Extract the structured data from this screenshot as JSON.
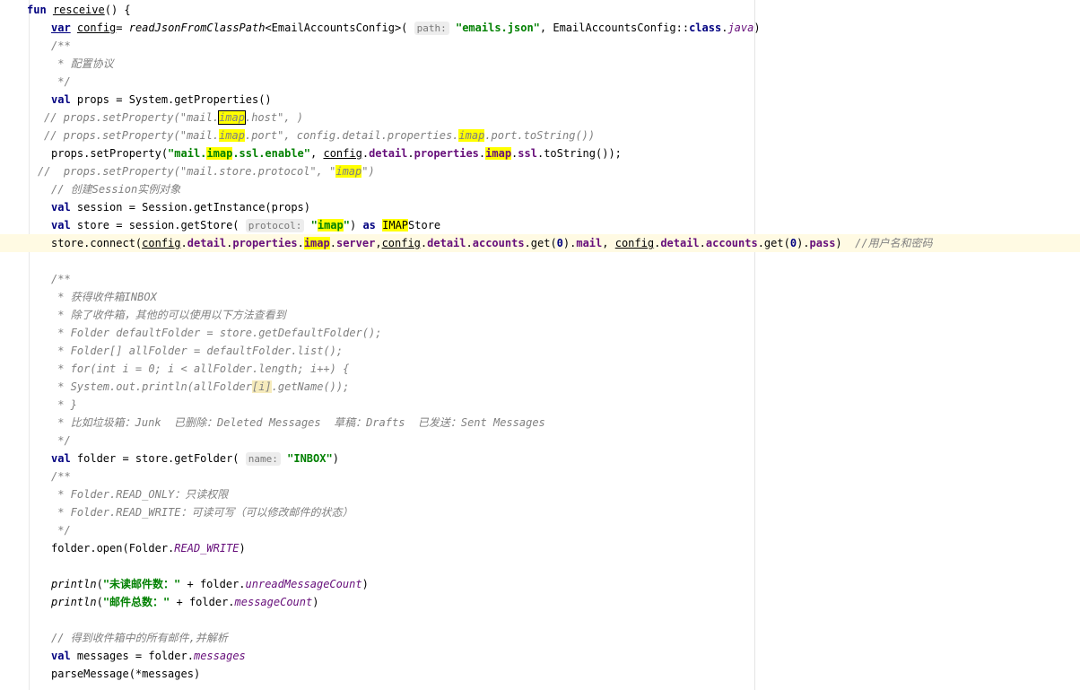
{
  "editor": {
    "lines": [
      {
        "indent": 30,
        "segs": [
          {
            "t": "fun",
            "c": "kw"
          },
          {
            "t": " "
          },
          {
            "t": "resceive",
            "c": "ul"
          },
          {
            "t": "() {"
          }
        ]
      },
      {
        "indent": 57,
        "segs": [
          {
            "t": "var",
            "c": "kw ul"
          },
          {
            "t": " "
          },
          {
            "t": "config",
            "c": "ul"
          },
          {
            "t": "= "
          },
          {
            "t": "readJsonFromClassPath",
            "c": "it"
          },
          {
            "t": "<EmailAccountsConfig>( "
          },
          {
            "t": "path:",
            "c": "hint"
          },
          {
            "t": " "
          },
          {
            "t": "\"emails.json\"",
            "c": "str"
          },
          {
            "t": ", EmailAccountsConfig::"
          },
          {
            "t": "class",
            "c": "kw"
          },
          {
            "t": "."
          },
          {
            "t": "java",
            "c": "sfld"
          },
          {
            "t": ")"
          }
        ]
      },
      {
        "indent": 57,
        "segs": [
          {
            "t": "/**",
            "c": "cmt"
          }
        ]
      },
      {
        "indent": 57,
        "segs": [
          {
            "t": " * 配置协议",
            "c": "cmt"
          }
        ]
      },
      {
        "indent": 57,
        "segs": [
          {
            "t": " */",
            "c": "cmt"
          }
        ]
      },
      {
        "indent": 57,
        "segs": [
          {
            "t": "val",
            "c": "kw"
          },
          {
            "t": " props = System.getProperties()"
          }
        ]
      },
      {
        "indent": 49,
        "segs": [
          {
            "t": "// props.setProperty(\"mail.",
            "c": "cmt"
          },
          {
            "t": "imap",
            "c": "cmt hlbox"
          },
          {
            "t": ".host\", )",
            "c": "cmt"
          }
        ]
      },
      {
        "indent": 49,
        "segs": [
          {
            "t": "// props.setProperty(\"mail.",
            "c": "cmt"
          },
          {
            "t": "imap",
            "c": "cmt hl"
          },
          {
            "t": ".port\", config.detail.properties.",
            "c": "cmt"
          },
          {
            "t": "imap",
            "c": "cmt hl"
          },
          {
            "t": ".port.toString())",
            "c": "cmt"
          }
        ]
      },
      {
        "indent": 57,
        "segs": [
          {
            "t": "props.setProperty("
          },
          {
            "t": "\"mail.",
            "c": "str"
          },
          {
            "t": "imap",
            "c": "str hl"
          },
          {
            "t": ".ssl.enable\"",
            "c": "str"
          },
          {
            "t": ", "
          },
          {
            "t": "config",
            "c": "ul"
          },
          {
            "t": "."
          },
          {
            "t": "detail",
            "c": "fld"
          },
          {
            "t": "."
          },
          {
            "t": "properties",
            "c": "fld"
          },
          {
            "t": "."
          },
          {
            "t": "imap",
            "c": "fld hl"
          },
          {
            "t": "."
          },
          {
            "t": "ssl",
            "c": "fld"
          },
          {
            "t": ".toString());"
          }
        ]
      },
      {
        "indent": 42,
        "segs": [
          {
            "t": "//  props.setProperty(\"mail.store.protocol\", \"",
            "c": "cmt"
          },
          {
            "t": "imap",
            "c": "cmt hl"
          },
          {
            "t": "\")",
            "c": "cmt"
          }
        ]
      },
      {
        "indent": 57,
        "segs": [
          {
            "t": "// 创建Session实例对象",
            "c": "cmt"
          }
        ]
      },
      {
        "indent": 57,
        "segs": [
          {
            "t": "val",
            "c": "kw"
          },
          {
            "t": " session = Session.getInstance(props)"
          }
        ]
      },
      {
        "indent": 57,
        "segs": [
          {
            "t": "val",
            "c": "kw"
          },
          {
            "t": " store = session.getStore( "
          },
          {
            "t": "protocol:",
            "c": "hint"
          },
          {
            "t": " "
          },
          {
            "t": "\"",
            "c": "str"
          },
          {
            "t": "imap",
            "c": "str hl"
          },
          {
            "t": "\"",
            "c": "str"
          },
          {
            "t": ") "
          },
          {
            "t": "as",
            "c": "kw"
          },
          {
            "t": " "
          },
          {
            "t": "IMAP",
            "c": "hl"
          },
          {
            "t": "Store"
          }
        ]
      },
      {
        "indent": 57,
        "segs": [
          {
            "t": "store.connect("
          },
          {
            "t": "config",
            "c": "ul"
          },
          {
            "t": "."
          },
          {
            "t": "detail",
            "c": "fld"
          },
          {
            "t": "."
          },
          {
            "t": "properties",
            "c": "fld"
          },
          {
            "t": "."
          },
          {
            "t": "imap",
            "c": "fld hl"
          },
          {
            "t": "."
          },
          {
            "t": "server",
            "c": "fld"
          },
          {
            "t": ","
          },
          {
            "t": "config",
            "c": "ul"
          },
          {
            "t": "."
          },
          {
            "t": "detail",
            "c": "fld"
          },
          {
            "t": "."
          },
          {
            "t": "accounts",
            "c": "fld"
          },
          {
            "t": ".get("
          },
          {
            "t": "0",
            "c": "kw"
          },
          {
            "t": ")."
          },
          {
            "t": "mail",
            "c": "fld"
          },
          {
            "t": ", "
          },
          {
            "t": "config",
            "c": "ul"
          },
          {
            "t": "."
          },
          {
            "t": "detail",
            "c": "fld"
          },
          {
            "t": "."
          },
          {
            "t": "accounts",
            "c": "fld"
          },
          {
            "t": ".get("
          },
          {
            "t": "0",
            "c": "kw"
          },
          {
            "t": ")."
          },
          {
            "t": "pass",
            "c": "fld"
          },
          {
            "t": ")  "
          },
          {
            "t": "//用户名和密码",
            "c": "cmt"
          }
        ]
      },
      {
        "indent": 57,
        "segs": []
      },
      {
        "indent": 57,
        "segs": [
          {
            "t": "/**",
            "c": "cmt"
          }
        ]
      },
      {
        "indent": 57,
        "segs": [
          {
            "t": " * 获得收件箱INBOX",
            "c": "cmt"
          }
        ]
      },
      {
        "indent": 57,
        "segs": [
          {
            "t": " * 除了收件箱，其他的可以使用以下方法查看到",
            "c": "cmt"
          }
        ]
      },
      {
        "indent": 57,
        "segs": [
          {
            "t": " * Folder defaultFolder = store.getDefaultFolder();",
            "c": "cmt"
          }
        ]
      },
      {
        "indent": 57,
        "segs": [
          {
            "t": " * Folder[] allFolder = defaultFolder.list();",
            "c": "cmt"
          }
        ]
      },
      {
        "indent": 57,
        "segs": [
          {
            "t": " * for(int i = 0; i < allFolder.length; i++) {",
            "c": "cmt"
          }
        ]
      },
      {
        "indent": 57,
        "segs": [
          {
            "t": " * System.out.println(allFolder",
            "c": "cmt"
          },
          {
            "t": "[i]",
            "c": "cmt warn"
          },
          {
            "t": ".getName());",
            "c": "cmt"
          }
        ]
      },
      {
        "indent": 57,
        "segs": [
          {
            "t": " * }",
            "c": "cmt"
          }
        ]
      },
      {
        "indent": 57,
        "segs": [
          {
            "t": " * 比如垃圾箱：Junk  已删除：Deleted Messages  草稿：Drafts  已发送：Sent Messages",
            "c": "cmt"
          }
        ]
      },
      {
        "indent": 57,
        "segs": [
          {
            "t": " */",
            "c": "cmt"
          }
        ]
      },
      {
        "indent": 57,
        "segs": [
          {
            "t": "val",
            "c": "kw"
          },
          {
            "t": " folder = store.getFolder( "
          },
          {
            "t": "name:",
            "c": "hint"
          },
          {
            "t": " "
          },
          {
            "t": "\"INBOX\"",
            "c": "str"
          },
          {
            "t": ")"
          }
        ]
      },
      {
        "indent": 57,
        "segs": [
          {
            "t": "/**",
            "c": "cmt"
          }
        ]
      },
      {
        "indent": 57,
        "segs": [
          {
            "t": " * Folder.READ_ONLY：只读权限",
            "c": "cmt"
          }
        ]
      },
      {
        "indent": 57,
        "segs": [
          {
            "t": " * Folder.READ_WRITE：可读可写（可以修改邮件的状态）",
            "c": "cmt"
          }
        ]
      },
      {
        "indent": 57,
        "segs": [
          {
            "t": " */",
            "c": "cmt"
          }
        ]
      },
      {
        "indent": 57,
        "segs": [
          {
            "t": "folder.open(Folder."
          },
          {
            "t": "READ_WRITE",
            "c": "sfld"
          },
          {
            "t": ")"
          }
        ]
      },
      {
        "indent": 57,
        "segs": []
      },
      {
        "indent": 57,
        "segs": [
          {
            "t": "println",
            "c": "it"
          },
          {
            "t": "("
          },
          {
            "t": "\"未读邮件数：\"",
            "c": "str"
          },
          {
            "t": " + folder."
          },
          {
            "t": "unreadMessageCount",
            "c": "sfld"
          },
          {
            "t": ")"
          }
        ]
      },
      {
        "indent": 57,
        "segs": [
          {
            "t": "println",
            "c": "it"
          },
          {
            "t": "("
          },
          {
            "t": "\"邮件总数：\"",
            "c": "str"
          },
          {
            "t": " + folder."
          },
          {
            "t": "messageCount",
            "c": "sfld"
          },
          {
            "t": ")"
          }
        ]
      },
      {
        "indent": 57,
        "segs": []
      },
      {
        "indent": 57,
        "segs": [
          {
            "t": "// 得到收件箱中的所有邮件,并解析",
            "c": "cmt"
          }
        ]
      },
      {
        "indent": 57,
        "segs": [
          {
            "t": "val",
            "c": "kw"
          },
          {
            "t": " messages = folder."
          },
          {
            "t": "messages",
            "c": "sfld"
          }
        ]
      },
      {
        "indent": 57,
        "segs": [
          {
            "t": "parseMessage(*messages)"
          }
        ]
      }
    ]
  }
}
